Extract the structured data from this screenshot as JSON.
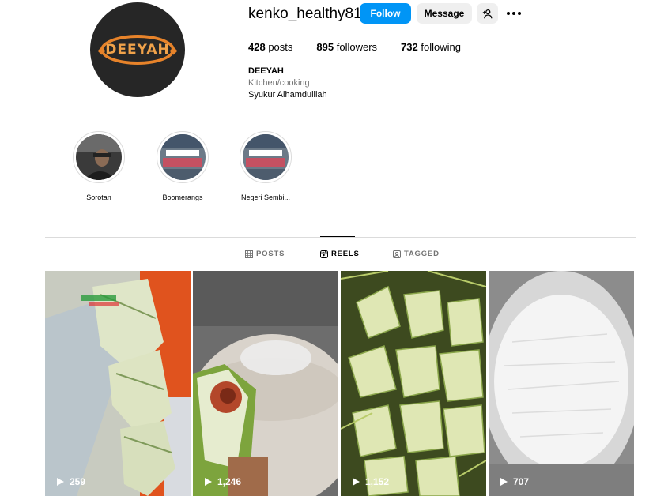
{
  "profile": {
    "username": "kenko_healthy81",
    "follow_label": "Follow",
    "message_label": "Message",
    "avatar_text": "DEEYAH",
    "stats": {
      "posts_count": "428",
      "posts_label": "posts",
      "followers_count": "895",
      "followers_label": "followers",
      "following_count": "732",
      "following_label": "following"
    },
    "bio": {
      "name": "DEEYAH",
      "category": "Kitchen/cooking",
      "text": "Syukur Alhamdulilah"
    }
  },
  "highlights": [
    {
      "label": "Sorotan"
    },
    {
      "label": "Boomerangs"
    },
    {
      "label": "Negeri Sembi..."
    }
  ],
  "tabs": [
    {
      "label": "POSTS",
      "icon": "grid-icon",
      "active": false
    },
    {
      "label": "REELS",
      "icon": "reels-icon",
      "active": true
    },
    {
      "label": "TAGGED",
      "icon": "tagged-icon",
      "active": false
    }
  ],
  "reels": [
    {
      "views": "259"
    },
    {
      "views": "1,246"
    },
    {
      "views": "1,152"
    },
    {
      "views": "707"
    }
  ],
  "colors": {
    "accent": "#0095f6",
    "secondary_button": "#efefef",
    "divider": "#dbdbdb",
    "muted_text": "#737373"
  }
}
